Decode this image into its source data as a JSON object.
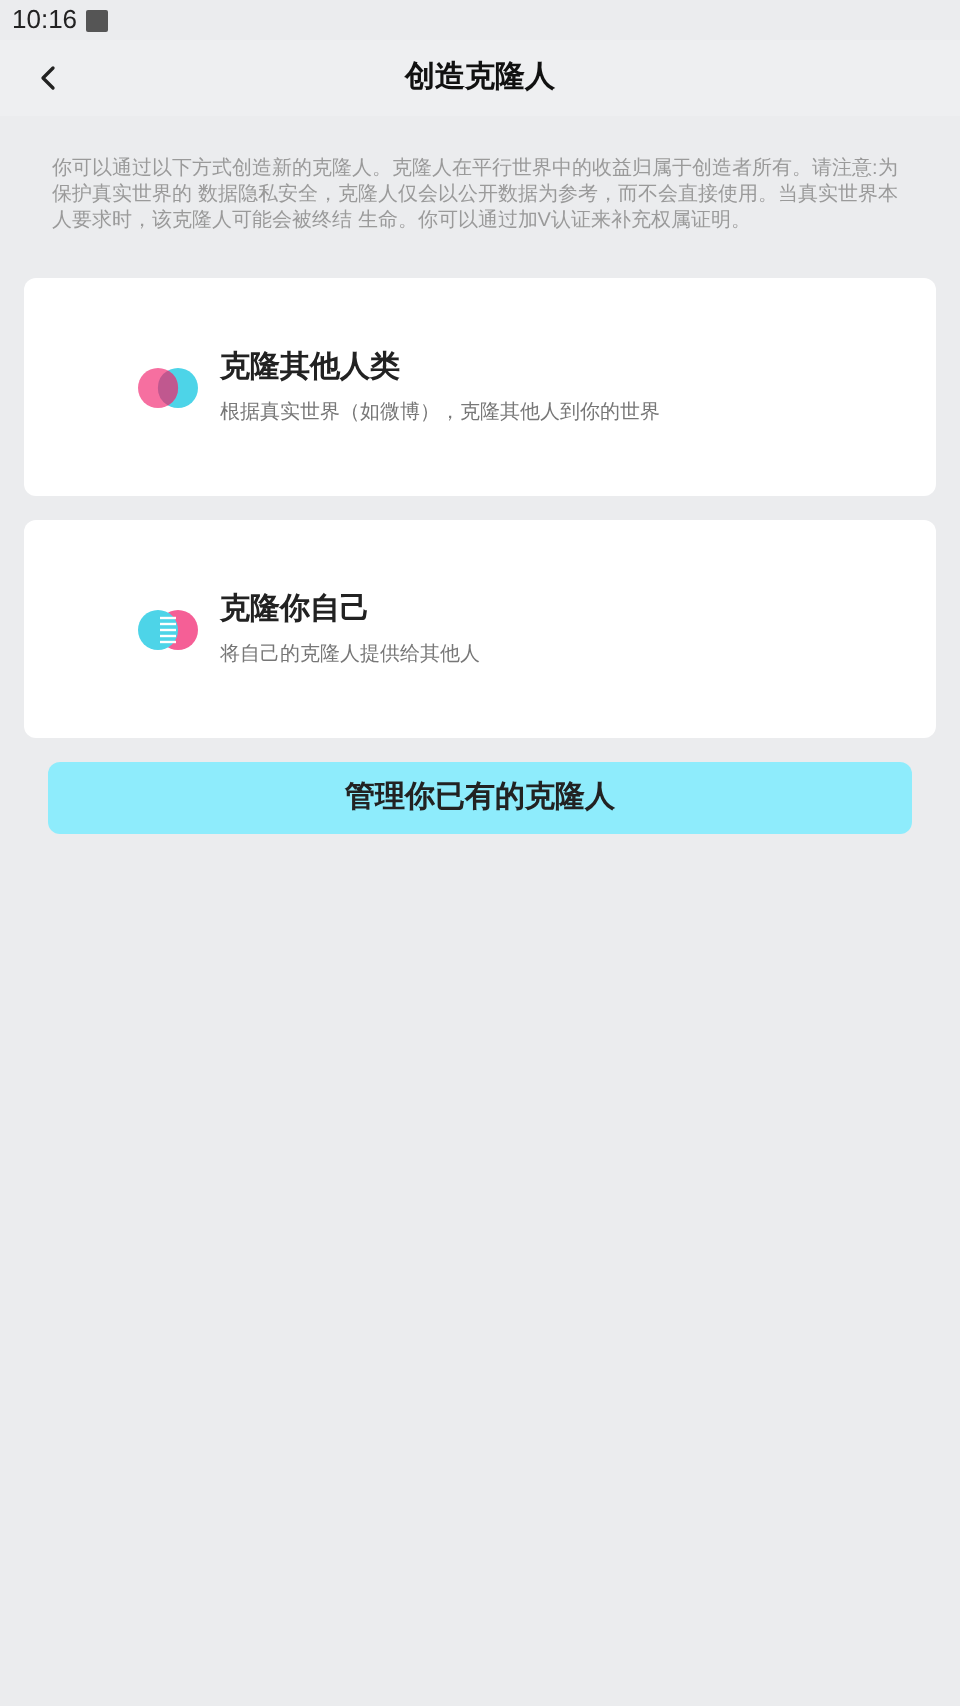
{
  "status_bar": {
    "time": "10:16"
  },
  "header": {
    "title": "创造克隆人"
  },
  "intro": "你可以通过以下方式创造新的克隆人。克隆人在平行世界中的收益归属于创造者所有。请注意:为保护真实世界的 数据隐私安全，克隆人仅会以公开数据为参考，而不会直接使用。当真实世界本人要求时，该克隆人可能会被终结 生命。你可以通过加V认证来补充权属证明。",
  "options": [
    {
      "kind": "others",
      "title": "克隆其他人类",
      "subtitle": "根据真实世界（如微博），克隆其他人到你的世界"
    },
    {
      "kind": "self",
      "title": "克隆你自己",
      "subtitle": "将自己的克隆人提供给其他人"
    }
  ],
  "manage_button": "管理你已有的克隆人"
}
